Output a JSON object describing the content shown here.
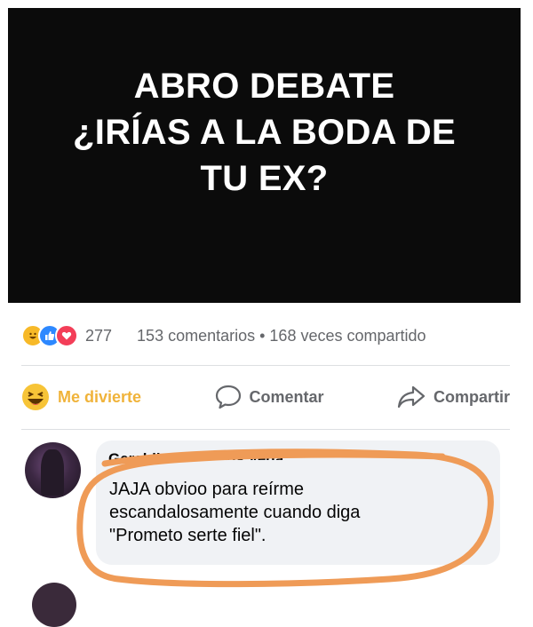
{
  "post": {
    "image_text_lines": [
      "ABRO DEBATE",
      "¿IRÍAS A LA BODA DE",
      "TU EX?"
    ]
  },
  "stats": {
    "reactions": [
      "haha-icon",
      "like-icon",
      "love-icon"
    ],
    "reaction_count": "277",
    "comments_shares": "153 comentarios • 168 veces compartido"
  },
  "actions": {
    "react_label": "Me divierte",
    "comment_label": "Comentar",
    "share_label": "Compartir"
  },
  "comment": {
    "author": "Geraldine Tec Rios Vega",
    "lines": [
      "JAJA obvioo para reírme",
      "escandalosamente cuando diga",
      "\"Prometo serte fiel\"."
    ]
  },
  "colors": {
    "haha_yellow": "#f7b928",
    "like_blue": "#2d88ff",
    "love_red": "#f33e58",
    "annotation_orange": "#ef9b57"
  }
}
